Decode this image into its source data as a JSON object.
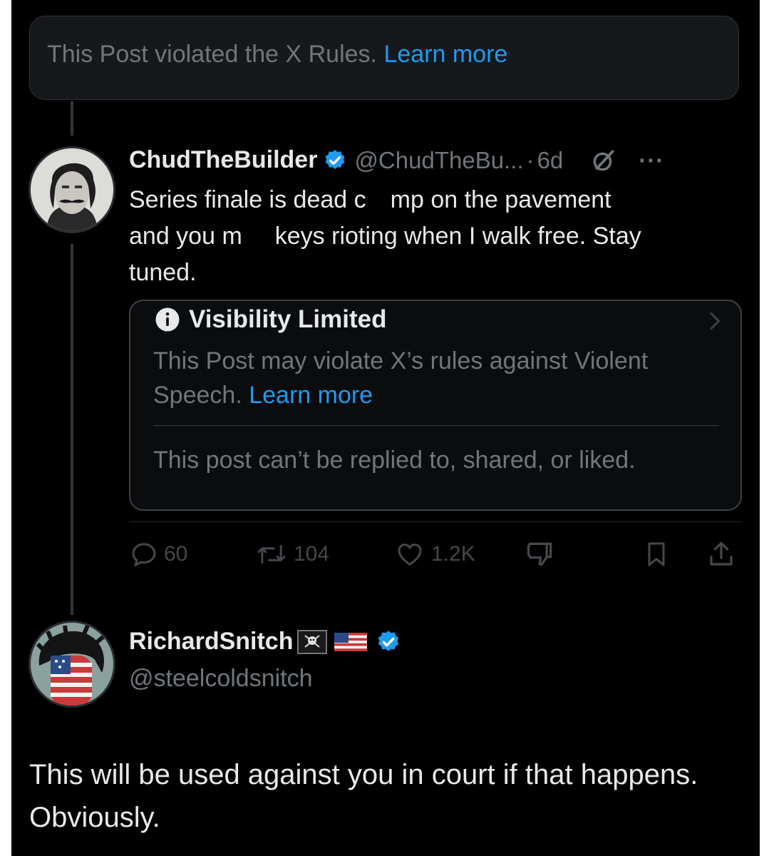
{
  "banner": {
    "text": "This Post violated the X Rules.",
    "link": "Learn more"
  },
  "post1": {
    "display_name": "ChudTheBuilder",
    "handle": "@ChudTheBu...",
    "separator": "·",
    "age": "6d",
    "more_label": "···",
    "line1a": "Series finale is dead c",
    "line1b": "mp on the pavement",
    "line2a": "and you m",
    "line2b": "keys rioting when I walk free. Stay",
    "line3": "tuned.",
    "visibility": {
      "title": "Visibility Limited",
      "desc": "This Post may violate X’s rules against Violent Speech.",
      "link": "Learn more",
      "note": "This post can’t be replied to, shared, or liked."
    },
    "actions": {
      "replies": "60",
      "reposts": "104",
      "likes": "1.2K"
    }
  },
  "post2": {
    "display_name": "RichardSnitch",
    "handle": "@steelcoldsnitch",
    "text": "This will be used against you in court if that happens. Obviously."
  },
  "colors": {
    "background": "#000000",
    "text": "#e7e9ea",
    "muted": "#71767b",
    "accent": "#1d9bf0",
    "verified": "#1d9bf0"
  },
  "icons": [
    "verified-badge-icon",
    "grok-slash-icon",
    "more-icon",
    "info-icon",
    "chevron-right-icon",
    "reply-icon",
    "repost-icon",
    "like-icon",
    "dislike-icon",
    "bookmark-icon",
    "share-icon",
    "pirate-flag-icon",
    "us-flag-icon"
  ]
}
